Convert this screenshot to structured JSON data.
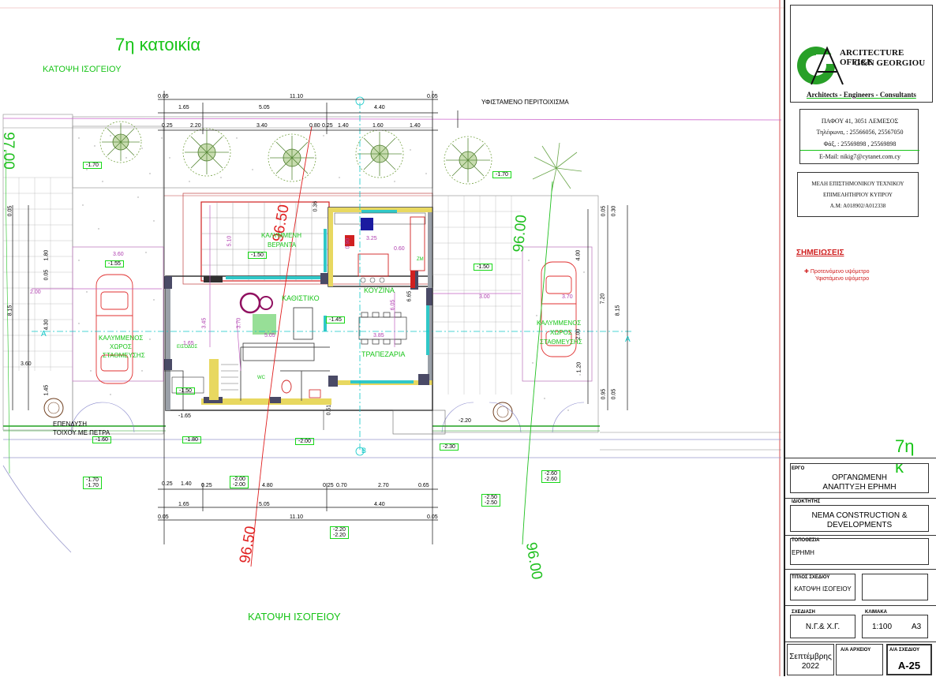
{
  "drawing": {
    "house_title": "7η κατοικία",
    "house_title_right": "7η κ",
    "plan_label_top": "ΚΑΤΟΨΗ ΙΣΟΓΕΙΟΥ",
    "plan_label_bottom": "ΚΑΤΟΨΗ ΙΣΟΓΕΙΟΥ",
    "existing_wall": "ΥΦΙΣΤΑΜΕΝΟ ΠΕΡΙΤΟΙΧΙΣΜΑ",
    "stone_wall_1": "ΕΠΕΝΔΥΣΗ",
    "stone_wall_2": "ΤΟΙΧΟΥ ΜΕ ΠΕΤΡΑ",
    "contour_left_1": "96.50",
    "contour_left_2": "96.50",
    "contour_right_1": "96.00",
    "contour_right_2": "96.00",
    "contour_far_left": "97.00",
    "section_a": "A",
    "section_b": "B",
    "rooms": {
      "veranda_1": "ΚΑΛΥΜΜΕΝΗ",
      "veranda_2": "ΒΕΡΑΝΤΑ",
      "sitting": "ΚΑΘΙΣΤΙΚΟ",
      "kitchen": "ΚΟΥΖΙΝΑ",
      "dining": "ΤΡΑΠΕΖΑΡΙΑ",
      "parking_left_1": "ΚΑΛΥΜΜΕΝΟΣ",
      "parking_left_2": "ΧΩΡΟΣ",
      "parking_left_3": "ΣΤΑΘΜΕΥΣΗΣ",
      "parking_right_1": "ΚΑΛΥΜΜΕΝΟΣ",
      "parking_right_2": "ΧΩΡΟΣ",
      "parking_right_3": "ΣΤΑΘΜΕΥΣΗΣ",
      "entrance": "ΕΙΣΟΔΟΣ",
      "wc": "WC",
      "zm": "ZM"
    },
    "dims_top_outer": [
      "0.05",
      "11.10",
      "0.05"
    ],
    "dims_top_mid": [
      "1.65",
      "5.05",
      "4.40"
    ],
    "dims_top_inner": [
      "0.25",
      "2.20",
      "3.40",
      "0.80",
      "0.25",
      "1.40",
      "1.60",
      "1.40"
    ],
    "dims_bottom_1": [
      "0.25",
      "1.40",
      "0.25",
      "4.80",
      "0.25",
      "0.70",
      "2.70",
      "0.65"
    ],
    "dims_bottom_2": [
      "1.65",
      "5.05",
      "4.40"
    ],
    "dims_bottom_3": [
      "0.05",
      "11.10",
      "0.05"
    ],
    "dims_right": [
      "0.05",
      "0.30",
      "4.00",
      "7.20",
      "8.15",
      "2.00",
      "1.20",
      "0.95",
      "0.05"
    ],
    "dims_left": [
      "0.05",
      "1.80",
      "0.05",
      "8.15",
      "4.30",
      "1.45"
    ],
    "inner_dims": [
      "3.60",
      "2.00",
      "3.25",
      "0.90",
      "0.60",
      "5.05",
      "3.85",
      "6.65",
      "6.05",
      "3.45",
      "3.70",
      "1.65",
      "3.00",
      "3.70",
      "0.51",
      "0.36",
      "5.10",
      "3.60"
    ],
    "levels": {
      "l_170_a": "-1.70",
      "l_170_b": "-1.70",
      "l_155": "-1.55",
      "l_150_a": "-1.50",
      "l_150_b": "-1.50",
      "l_145": "-1.45",
      "l_150_c": "-1.50",
      "l_165": "-1.65",
      "l_160": "-1.60",
      "l_180": "-1.80",
      "l_200_a": "-2.00",
      "l_200_b": "-2.00",
      "l_200_c": "-2.00",
      "l_220_a": "-2.20",
      "l_220_b": "-2.20",
      "l_220_c": "-2.20",
      "l_230": "-2.30",
      "l_250_a": "-2.50",
      "l_250_b": "-2.50",
      "l_260_a": "-2.60",
      "l_260_b": "-2.60",
      "l_170_c": "-1.70",
      "l_170_d": "-1.70"
    }
  },
  "title_block": {
    "office_1": "ARCITECTURE OFFICE",
    "office_2": "G&N GEORGIOU",
    "tagline": "Architects - Engineers - Consultants",
    "address": "ΠΑΦΟΥ 41, 3051 ΛΕΜΕΣΟΣ",
    "phones": "Τηλέφωνα, : 25566056, 25567050",
    "fax": "Φάξ, : 25569898 , 25569898",
    "email": "E-Mail: nikig7@cytanet.com.cy",
    "members_1": "ΜΕΛΗ ΕΠΙΣΤΗΜΟΝΙΚΟΥ ΤΕΧΝΙΚΟΥ",
    "members_2": "ΕΠΙΜΕΛΗΤΗΡΙΟΥ ΚΥΠΡΟΥ",
    "members_3": "Α.Μ: Α018902/Α012338",
    "notes_title": "ΣΗΜΕΙΩΣΕΙΣ",
    "legend_proposed": "Προτεινόμενο υψόμετρο",
    "legend_existing": "Υφιστάμενο υψόμετρο",
    "project_label": "ΕΡΓΟ",
    "project_1": "ΟΡΓΑΝΩΜΕΝΗ",
    "project_2": "ΑΝΑΠΤΥΞΗ ΕΡΗΜΗ",
    "owner_label": "ΙΔΙΟΚΤΗΤΗΣ",
    "owner_1": "NEMA CONSTRUCTION &",
    "owner_2": "DEVELOPMENTS",
    "location_label": "ΤΟΠΟΘΕΣΙΑ",
    "location": "ΕΡΗΜΗ",
    "drawing_title_label": "ΤΙΤΛΟΣ ΣΧΕΔΙΟΥ",
    "drawing_title": "ΚΑΤΟΨΗ ΙΣΟΓΕΙΟΥ",
    "designer_label": "ΣΧΕΔΙΑΣΗ",
    "designer": "Ν.Γ.& Χ.Γ.",
    "scale_label": "ΚΛΙΜΑΚΑ",
    "scale": "1:100",
    "paper": "Α3",
    "date_1": "Σεπτέμβρης",
    "date_2": "2022",
    "file_no_label": "Α/Α ΑΡΧΕΙΟΥ",
    "sheet_no_label": "Α/Α ΣΧΕΔΙΟΥ",
    "sheet_no": "A-25"
  },
  "colors": {
    "green_text": "#16c416",
    "red_line": "#e01818",
    "magenta": "#c050c0",
    "cyan": "#10c8c8",
    "level_box": "#18d818",
    "frame": "#d03030"
  }
}
